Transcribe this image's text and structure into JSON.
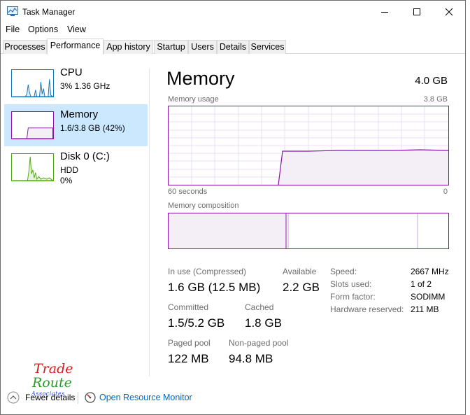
{
  "window": {
    "title": "Task Manager"
  },
  "menu": [
    "File",
    "Options",
    "View"
  ],
  "tabs": [
    "Processes",
    "Performance",
    "App history",
    "Startup",
    "Users",
    "Details",
    "Services"
  ],
  "sidebar": {
    "items": [
      {
        "title": "CPU",
        "line1": "3%  1.36 GHz",
        "line2": ""
      },
      {
        "title": "Memory",
        "line1": "1.6/3.8 GB (42%)",
        "line2": ""
      },
      {
        "title": "Disk 0 (C:)",
        "line1": "HDD",
        "line2": "0%"
      }
    ]
  },
  "memory": {
    "title": "Memory",
    "total": "4.0 GB",
    "usage_label": "Memory usage",
    "usage_max": "3.8 GB",
    "time_label": "60 seconds",
    "time_end": "0",
    "composition_label": "Memory composition",
    "in_use_usage_fraction": 0.42
  },
  "stats": {
    "in_use_label": "In use (Compressed)",
    "in_use_value": "1.6 GB (12.5 MB)",
    "available_label": "Available",
    "available_value": "2.2 GB",
    "committed_label": "Committed",
    "committed_value": "1.5/5.2 GB",
    "cached_label": "Cached",
    "cached_value": "1.8 GB",
    "paged_label": "Paged pool",
    "paged_value": "122 MB",
    "nonpaged_label": "Non-paged pool",
    "nonpaged_value": "94.8 MB"
  },
  "specs": [
    {
      "label": "Speed:",
      "value": "2667 MHz"
    },
    {
      "label": "Slots used:",
      "value": "1 of 2"
    },
    {
      "label": "Form factor:",
      "value": "SODIMM"
    },
    {
      "label": "Hardware reserved:",
      "value": "211 MB"
    }
  ],
  "footer": {
    "fewer_details": "Fewer details",
    "resource_monitor": "Open Resource Monitor"
  },
  "watermark": {
    "line1": "Trade",
    "line2": "Route",
    "line3": "Associates"
  },
  "colors": {
    "memory": "#8b12ae",
    "cpu": "#1177bb",
    "disk": "#4da60c",
    "selected": "#cce8ff",
    "link": "#0066cc"
  }
}
